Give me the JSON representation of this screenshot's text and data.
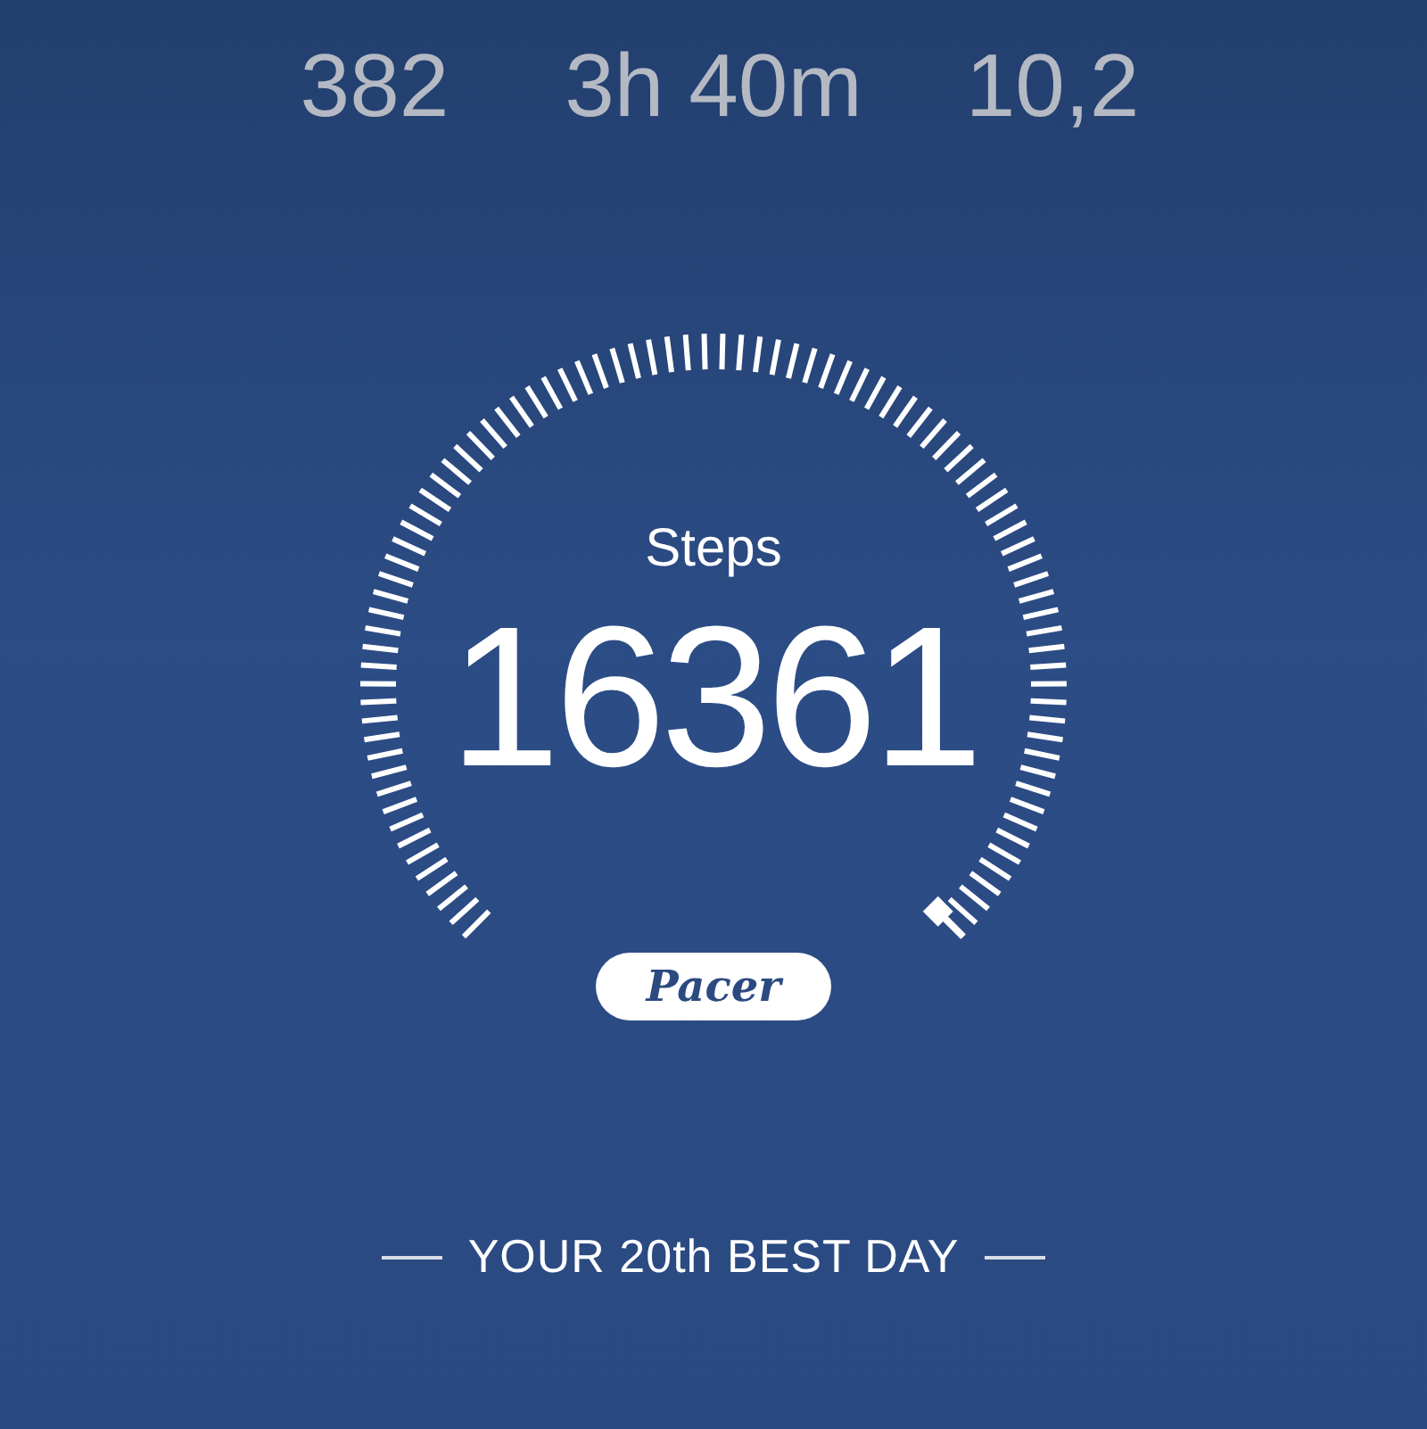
{
  "stats": [
    {
      "value": "382"
    },
    {
      "value": "3h 40m"
    },
    {
      "value": "10,2"
    }
  ],
  "gauge": {
    "label": "Steps",
    "value": "16361"
  },
  "badge": "Pacer",
  "footer": "YOUR 20th BEST DAY"
}
